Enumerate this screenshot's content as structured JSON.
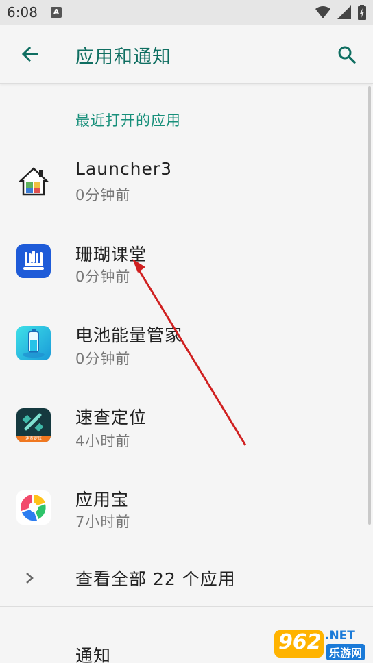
{
  "status_bar": {
    "time": "6:08",
    "notification_icon": "A"
  },
  "app_bar": {
    "title": "应用和通知",
    "back_icon": "arrow-back-icon",
    "search_icon": "search-icon"
  },
  "recent": {
    "header": "最近打开的应用",
    "apps": [
      {
        "name": "Launcher3",
        "time": "0分钟前",
        "icon": "launcher-icon"
      },
      {
        "name": "珊瑚课堂",
        "time": "0分钟前",
        "icon": "shanhu-icon"
      },
      {
        "name": "电池能量管家",
        "time": "0分钟前",
        "icon": "battery-manager-icon"
      },
      {
        "name": "速查定位",
        "time": "4小时前",
        "icon": "locator-icon",
        "icon_text": "速查定位"
      },
      {
        "name": "应用宝",
        "time": "7小时前",
        "icon": "yingyongbao-icon"
      }
    ]
  },
  "see_all": {
    "label": "查看全部 22 个应用"
  },
  "notifications": {
    "title": "通知"
  },
  "watermark": {
    "brand": "962",
    "suffix": ".NET",
    "tagline": "乐游网"
  },
  "colors": {
    "accent": "#0f6e61",
    "section": "#178f7a",
    "annotation_arrow": "#d02020"
  }
}
